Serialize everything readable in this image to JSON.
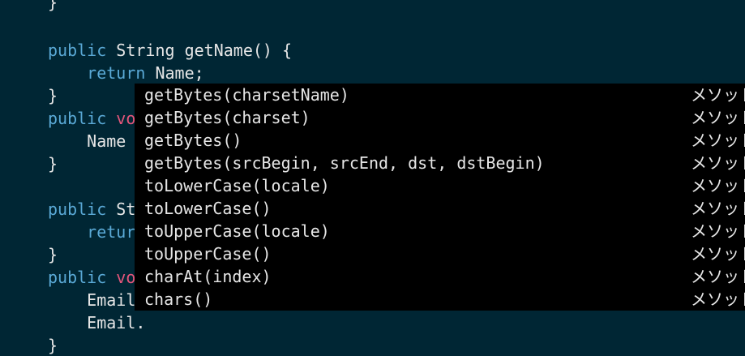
{
  "editor": {
    "lines": [
      {
        "id": "l0",
        "indent": "",
        "parts": [
          {
            "t": "}",
            "c": "plain"
          }
        ]
      },
      {
        "id": "l1",
        "indent": "",
        "parts": []
      },
      {
        "id": "l2",
        "indent": "",
        "parts": [
          {
            "t": "public",
            "c": "kw"
          },
          {
            "t": " String getName() {",
            "c": "plain"
          }
        ]
      },
      {
        "id": "l3",
        "indent": "    ",
        "parts": [
          {
            "t": "return",
            "c": "kw"
          },
          {
            "t": " Name;",
            "c": "plain"
          }
        ]
      },
      {
        "id": "l4",
        "indent": "",
        "parts": [
          {
            "t": "}",
            "c": "plain"
          }
        ]
      },
      {
        "id": "l5",
        "indent": "",
        "parts": [
          {
            "t": "public",
            "c": "kw"
          },
          {
            "t": " ",
            "c": "plain"
          },
          {
            "t": "vo",
            "c": "kw-red"
          }
        ]
      },
      {
        "id": "l6",
        "indent": "    ",
        "parts": [
          {
            "t": "Name",
            "c": "plain"
          }
        ]
      },
      {
        "id": "l7",
        "indent": "",
        "parts": [
          {
            "t": "}",
            "c": "plain"
          }
        ]
      },
      {
        "id": "l8",
        "indent": "",
        "parts": []
      },
      {
        "id": "l9",
        "indent": "",
        "parts": [
          {
            "t": "public",
            "c": "kw"
          },
          {
            "t": " St",
            "c": "plain"
          }
        ]
      },
      {
        "id": "l10",
        "indent": "    ",
        "parts": [
          {
            "t": "retur",
            "c": "kw"
          }
        ]
      },
      {
        "id": "l11",
        "indent": "",
        "parts": [
          {
            "t": "}",
            "c": "plain"
          }
        ]
      },
      {
        "id": "l12",
        "indent": "",
        "parts": [
          {
            "t": "public",
            "c": "kw"
          },
          {
            "t": " ",
            "c": "plain"
          },
          {
            "t": "vo",
            "c": "kw-red"
          }
        ]
      },
      {
        "id": "l13",
        "indent": "    ",
        "parts": [
          {
            "t": "Email",
            "c": "plain"
          }
        ]
      },
      {
        "id": "l14",
        "indent": "    ",
        "parts": [
          {
            "t": "Email.",
            "c": "plain"
          }
        ]
      },
      {
        "id": "l15",
        "indent": "",
        "parts": [
          {
            "t": "}",
            "c": "plain"
          }
        ]
      }
    ]
  },
  "completion": {
    "items": [
      {
        "label": "getBytes(charsetName)",
        "kind": "メソッド"
      },
      {
        "label": "getBytes(charset)",
        "kind": "メソッド"
      },
      {
        "label": "getBytes()",
        "kind": "メソッド"
      },
      {
        "label": "getBytes(srcBegin, srcEnd, dst, dstBegin)",
        "kind": "メソッド"
      },
      {
        "label": "toLowerCase(locale)",
        "kind": "メソッド"
      },
      {
        "label": "toLowerCase()",
        "kind": "メソッド"
      },
      {
        "label": "toUpperCase(locale)",
        "kind": "メソッド"
      },
      {
        "label": "toUpperCase()",
        "kind": "メソッド"
      },
      {
        "label": "charAt(index)",
        "kind": "メソッド"
      },
      {
        "label": "chars()",
        "kind": "メソッド"
      }
    ]
  },
  "colors": {
    "background": "#002634",
    "keyword": "#5aa9d6",
    "keyword_alt": "#e2557a",
    "text": "#e6e6e6",
    "popup_background": "#000000"
  }
}
